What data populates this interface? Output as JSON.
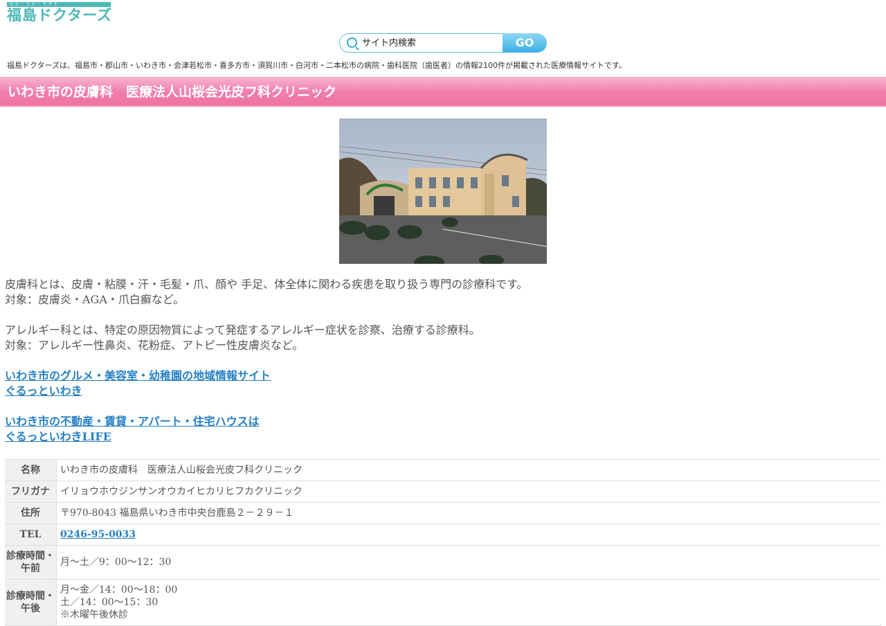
{
  "header": {
    "logo_top": "もん・ちん・すきす",
    "logo_text": "福島ドクターズ"
  },
  "search": {
    "placeholder": "サイト内検索",
    "go_label": "GO"
  },
  "tagline": "福島ドクターズは、福島市・郡山市・いわき市・会津若松市・喜多方市・須賀川市・白河市・二本松市の病院・歯科医院（歯医者）の情報2100件が掲載された医療情報サイトです。",
  "title": "いわき市の皮膚科　医療法人山桜会光皮フ科クリニック",
  "description": {
    "derm_line1": "皮膚科とは、皮膚・粘膜・汗・毛髪・爪、顔や 手足、体全体に関わる疾患を取り扱う専門の診療科です。",
    "derm_line2": "対象：皮膚炎・AGA・爪白癬など。",
    "allergy_line1": "アレルギー科とは、特定の原因物質によって発症するアレルギー症状を診察、治療する診療科。",
    "allergy_line2": "対象：アレルギー性鼻炎、花粉症、アトピー性皮膚炎など。"
  },
  "links": {
    "gourmet_line1": "いわき市のグルメ・美容室・幼稚園の地域情報サイト",
    "gourmet_line2": "ぐるっといわき",
    "realestate_line1": "いわき市の不動産・賃貸・アパート・住宅ハウスは",
    "realestate_line2": "ぐるっといわきLIFE"
  },
  "info": {
    "name_label": "名称",
    "name_value": "いわき市の皮膚科　医療法人山桜会光皮フ科クリニック",
    "kana_label": "フリガナ",
    "kana_value": "イリョウホウジンサンオウカイヒカリヒフカクリニック",
    "address_label": "住所",
    "address_value": "〒970-8043 福島県いわき市中央台鹿島２－２９－１",
    "tel_label": "TEL",
    "tel_value": "0246-95-0033",
    "am_label": "診療時間・午前",
    "am_value": "月～土／9：00～12：30",
    "pm_label": "診療時間・午後",
    "pm_line1": "月～金／14：00～18：00",
    "pm_line2": "土／14：00～15：30",
    "pm_line3": "※木曜午後休診"
  }
}
